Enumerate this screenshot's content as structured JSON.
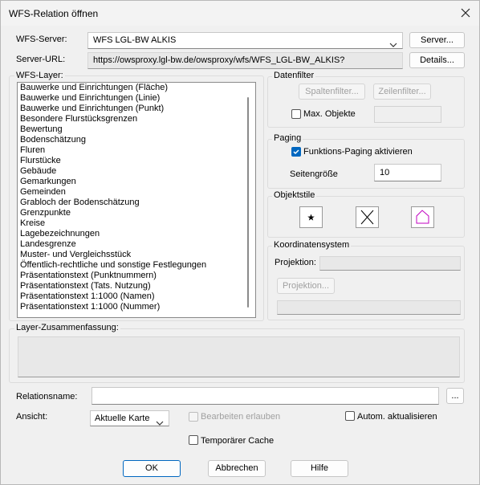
{
  "window": {
    "title": "WFS-Relation öffnen"
  },
  "server": {
    "label": "WFS-Server:",
    "value": "WFS LGL-BW ALKIS",
    "button": "Server...",
    "url_label": "Server-URL:",
    "url_value": "https://owsproxy.lgl-bw.de/owsproxy/wfs/WFS_LGL-BW_ALKIS?",
    "details_button": "Details..."
  },
  "layers": {
    "title": "WFS-Layer:",
    "items": [
      "Bauwerke und Einrichtungen (Fläche)",
      "Bauwerke und Einrichtungen (Linie)",
      "Bauwerke und Einrichtungen (Punkt)",
      "Besondere Flurstücksgrenzen",
      "Bewertung",
      "Bodenschätzung",
      "Fluren",
      "Flurstücke",
      "Gebäude",
      "Gemarkungen",
      "Gemeinden",
      "Grabloch der Bodenschätzung",
      "Grenzpunkte",
      "Kreise",
      "Lagebezeichnungen",
      "Landesgrenze",
      "Muster- und Vergleichsstück",
      "Öffentlich-rechtliche und sonstige Festlegungen",
      "Präsentationstext (Punktnummern)",
      "Präsentationstext (Tats. Nutzung)",
      "Präsentationstext 1:1000 (Namen)",
      "Präsentationstext 1:1000 (Nummer)"
    ]
  },
  "datenfilter": {
    "title": "Datenfilter",
    "spalten": "Spaltenfilter...",
    "zeilen": "Zeilenfilter...",
    "max_label": "Max. Objekte"
  },
  "paging": {
    "title": "Paging",
    "checkbox": "Funktions-Paging aktivieren",
    "size_label": "Seitengröße",
    "size_value": "10"
  },
  "objektstile": {
    "title": "Objektstile"
  },
  "koordinaten": {
    "title": "Koordinatensystem",
    "projektion_label": "Projektion:",
    "projektion_button": "Projektion..."
  },
  "summary": {
    "title": "Layer-Zusammenfassung:"
  },
  "relation": {
    "label": "Relationsname:",
    "browse": "..."
  },
  "ansicht": {
    "label": "Ansicht:",
    "value": "Aktuelle Karte",
    "bearbeiten": "Bearbeiten erlauben",
    "autom": "Autom. aktualisieren",
    "cache": "Temporärer Cache"
  },
  "footer": {
    "ok": "OK",
    "cancel": "Abbrechen",
    "help": "Hilfe"
  }
}
